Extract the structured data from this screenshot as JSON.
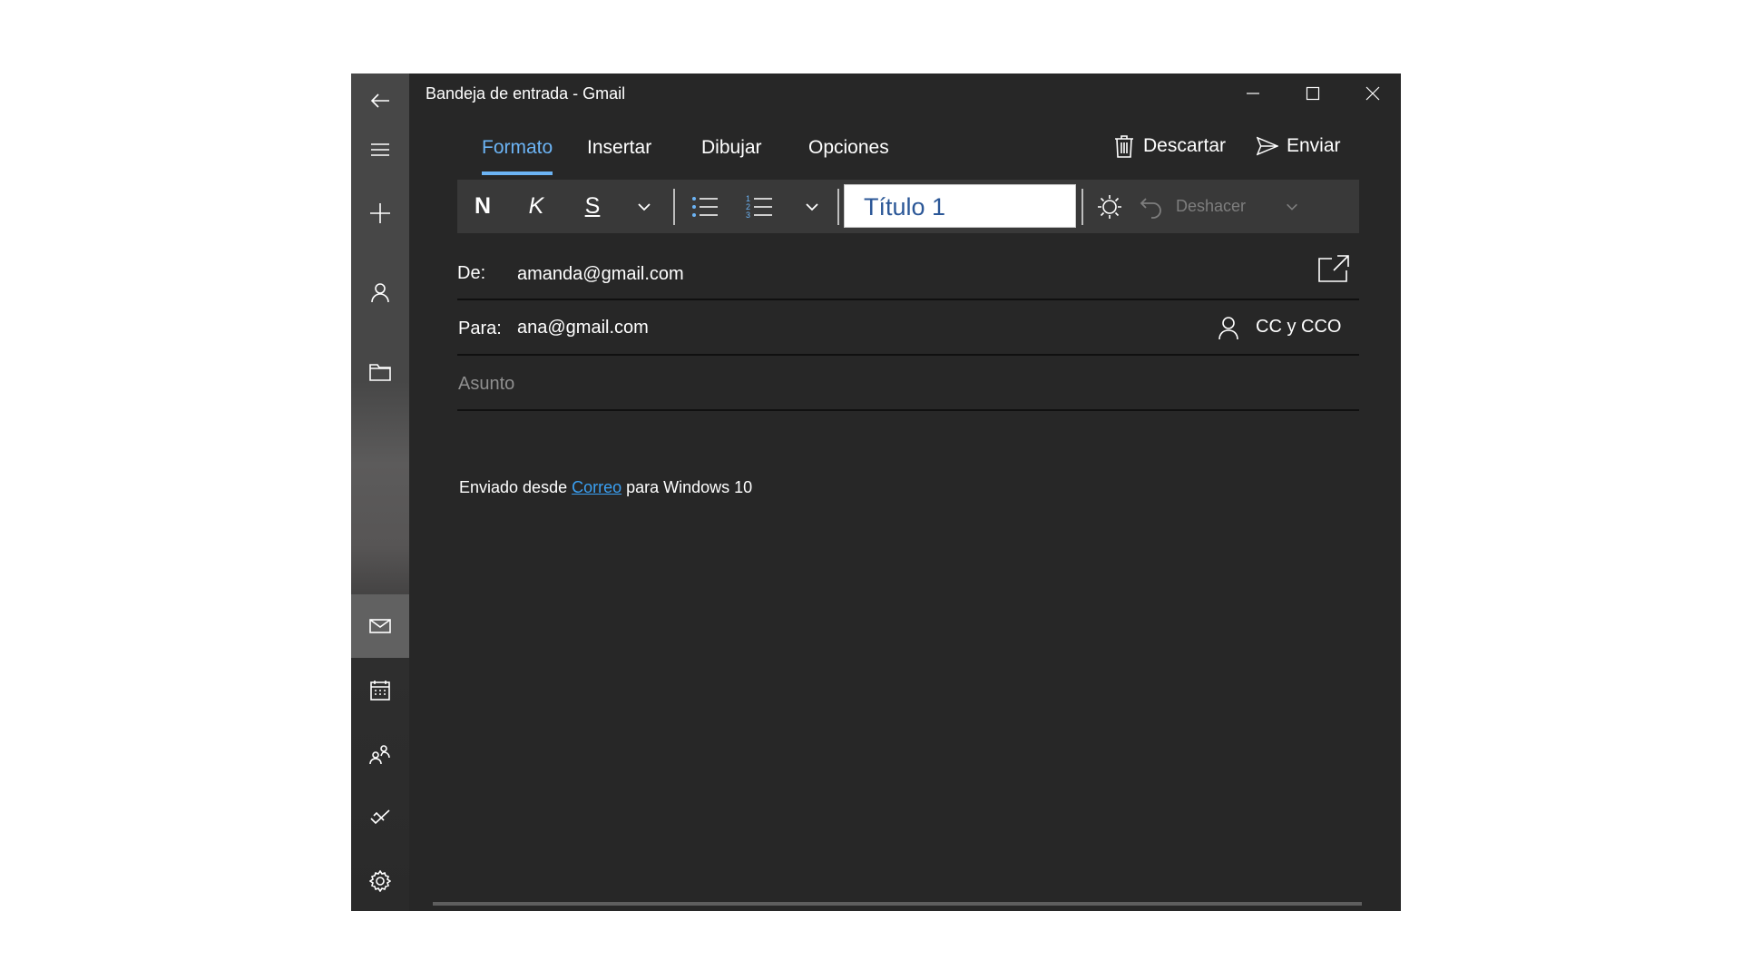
{
  "window": {
    "title": "Bandeja de entrada - Gmail"
  },
  "rail": {
    "icons": [
      "back-arrow-icon",
      "hamburger-menu-icon",
      "new-mail-plus-icon",
      "account-person-icon",
      "folder-icon",
      "mail-icon",
      "calendar-icon",
      "people-icon",
      "todo-check-icon",
      "settings-gear-icon"
    ],
    "active": "mail-icon"
  },
  "tabs": [
    {
      "label": "Formato",
      "active": true
    },
    {
      "label": "Insertar",
      "active": false
    },
    {
      "label": "Dibujar",
      "active": false
    },
    {
      "label": "Opciones",
      "active": false
    }
  ],
  "actions": {
    "discard_label": "Descartar",
    "send_label": "Enviar"
  },
  "toolbar": {
    "bold": "N",
    "italic": "K",
    "underline": "S",
    "style_value": "Título 1",
    "undo_label": "Deshacer"
  },
  "fields": {
    "from_label": "De:",
    "from_value": "amanda@gmail.com",
    "to_label": "Para:",
    "to_value": "ana@gmail.com",
    "cc_label": "CC y CCO",
    "subject_placeholder": "Asunto"
  },
  "body": {
    "sig_prefix": "Enviado desde ",
    "sig_link": "Correo",
    "sig_suffix": " para Windows 10"
  },
  "colors": {
    "accent": "#6cb4f5",
    "link": "#3aa0f3",
    "background": "#272727"
  }
}
